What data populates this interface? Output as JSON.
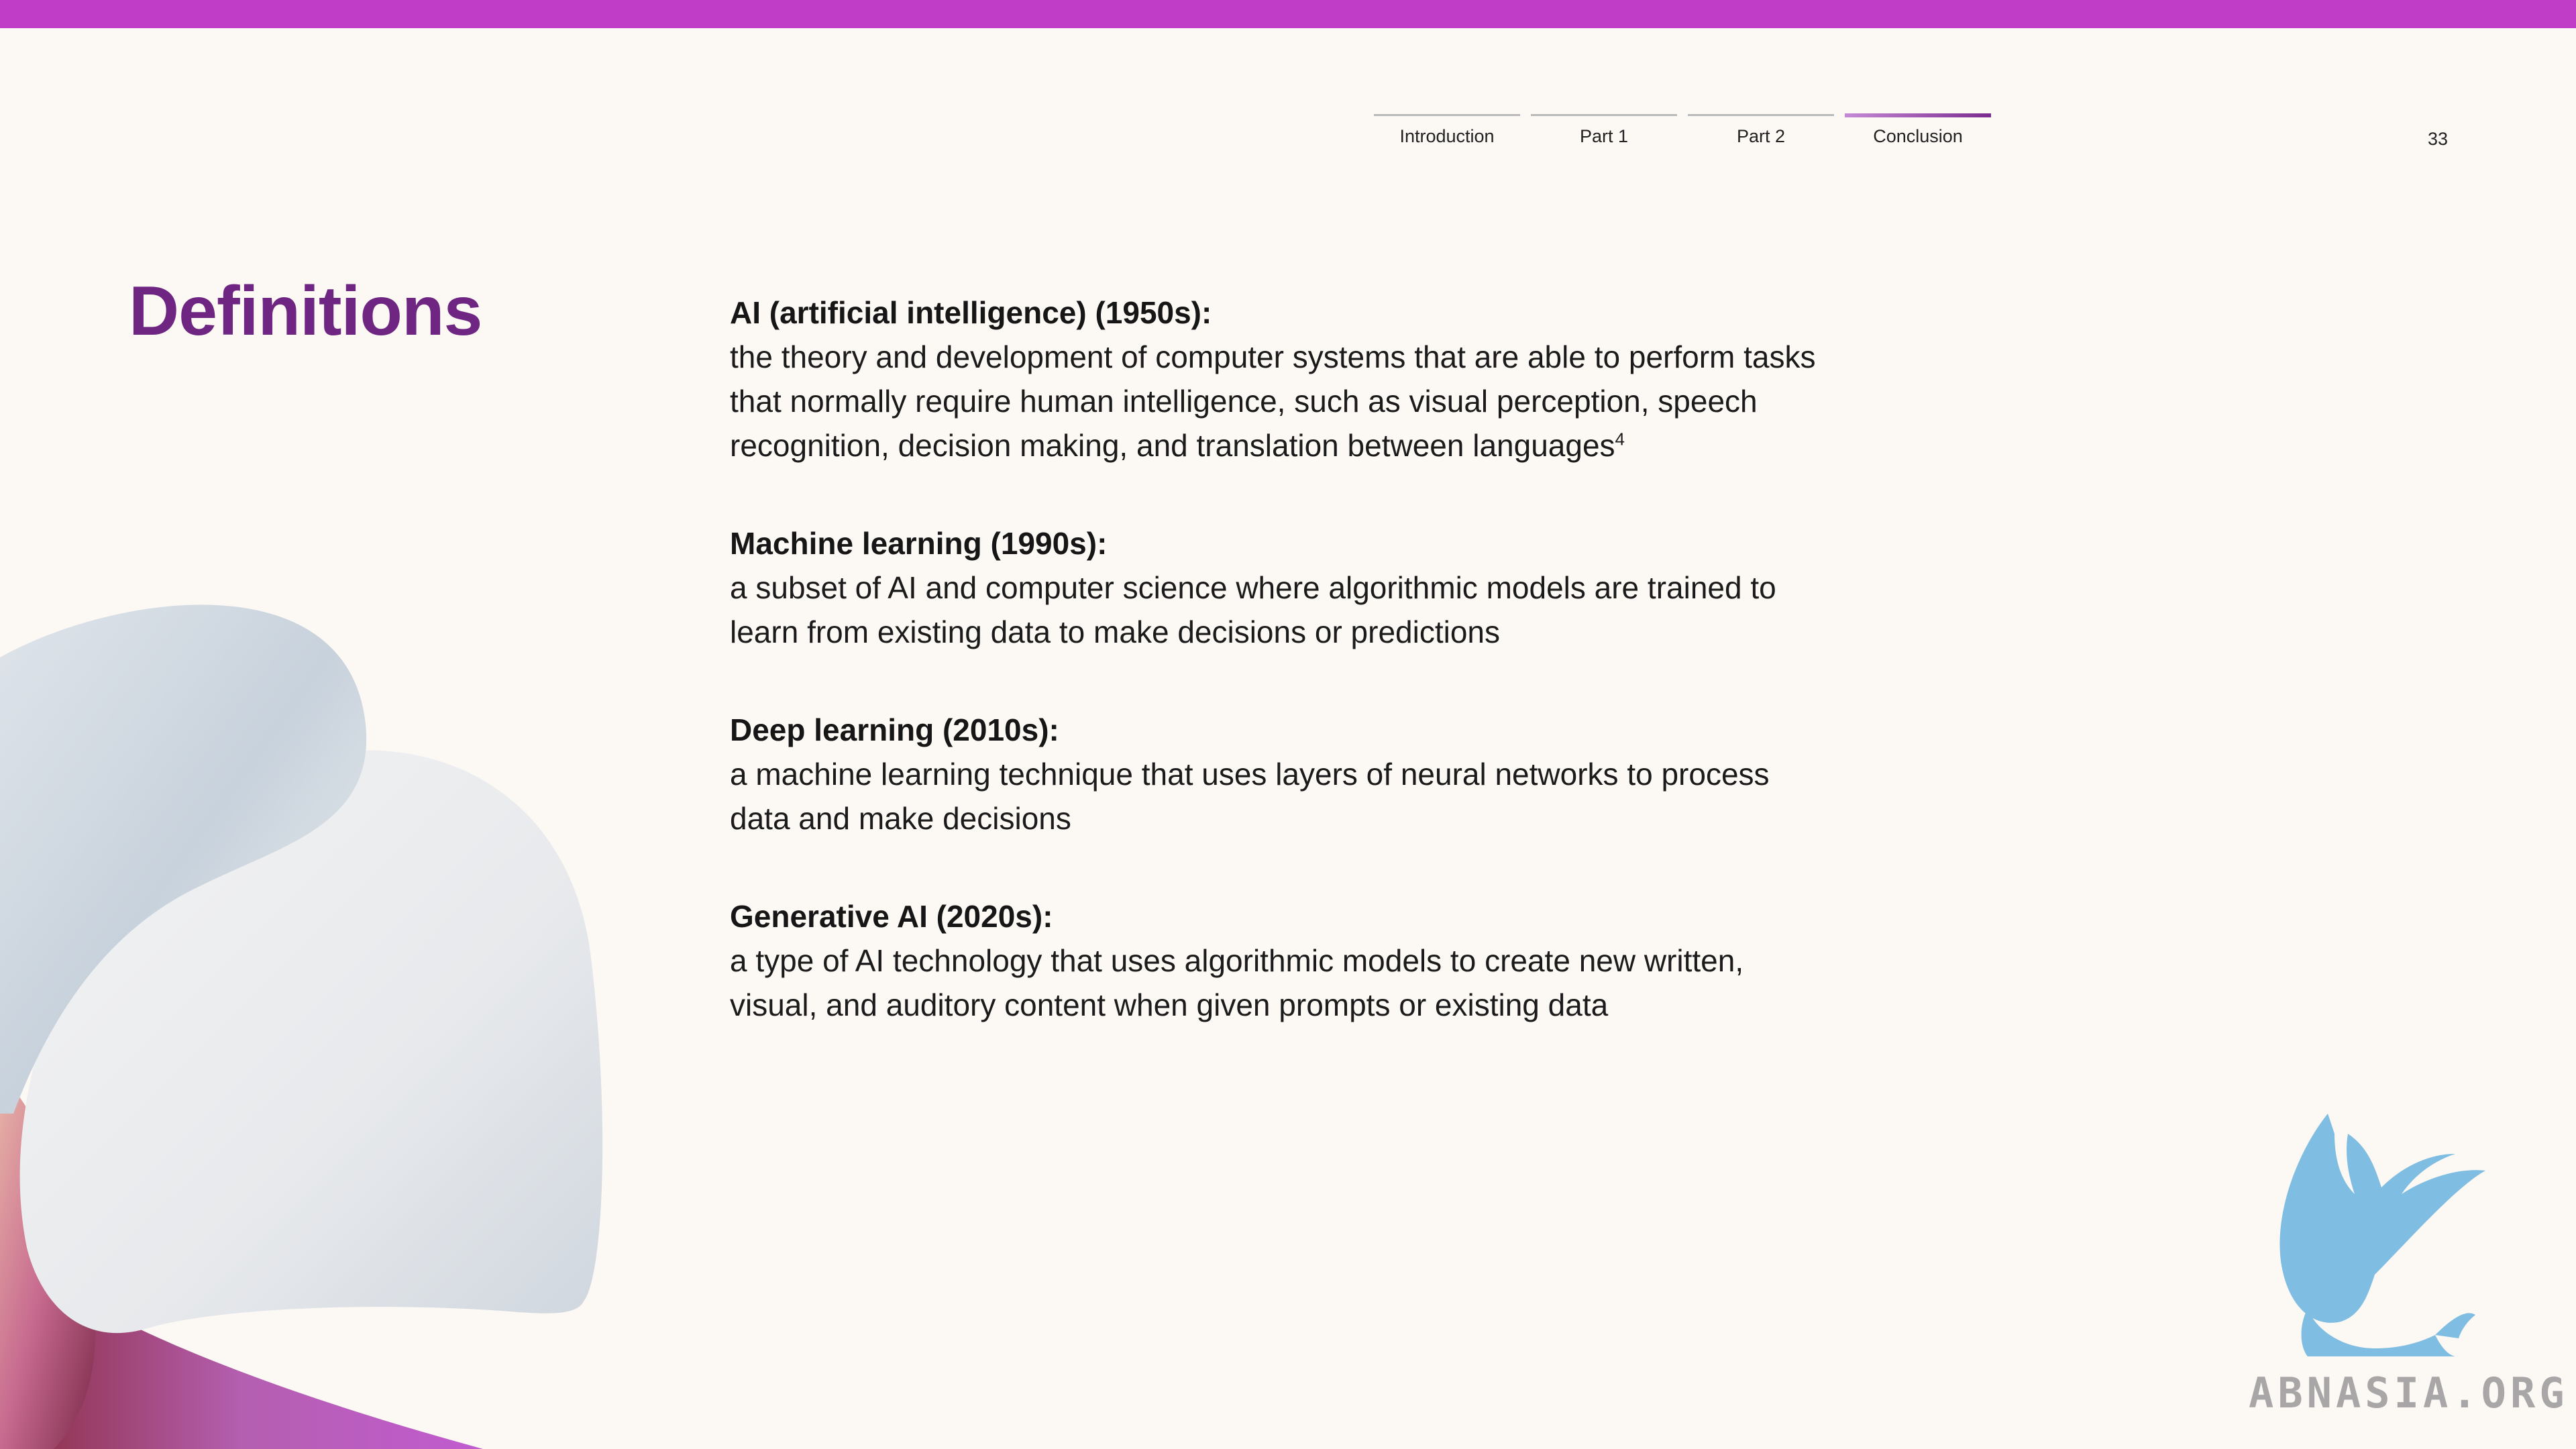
{
  "nav": {
    "tabs": [
      {
        "label": "Introduction",
        "active": false
      },
      {
        "label": "Part 1",
        "active": false
      },
      {
        "label": "Part 2",
        "active": false
      },
      {
        "label": "Conclusion",
        "active": true
      }
    ]
  },
  "page_number": "33",
  "title": "Definitions",
  "definitions": [
    {
      "term": "AI (artificial intelligence) (1950s)",
      "text": "the theory and development of computer systems that are able to perform tasks that normally require human intelligence, such as visual perception, speech recognition, decision making, and translation between languages",
      "footnote": "4"
    },
    {
      "term": "Machine learning (1990s)",
      "text": "a subset of AI and computer science where algorithmic models are trained to learn from existing data to make decisions or predictions"
    },
    {
      "term": "Deep learning (2010s)",
      "text": "a machine learning technique that uses layers of neural networks to process data and make decisions"
    },
    {
      "term": "Generative AI (2020s)",
      "text": "a type of AI technology that uses algorithmic models to create new written, visual, and auditory content when given prompts or existing data"
    }
  ],
  "watermark": {
    "text": "ABNASIA.ORG",
    "icon": "griffin-icon"
  },
  "colors": {
    "accent_bar": "#c03dc8",
    "title": "#6e2682",
    "background": "#fcf8f4"
  }
}
